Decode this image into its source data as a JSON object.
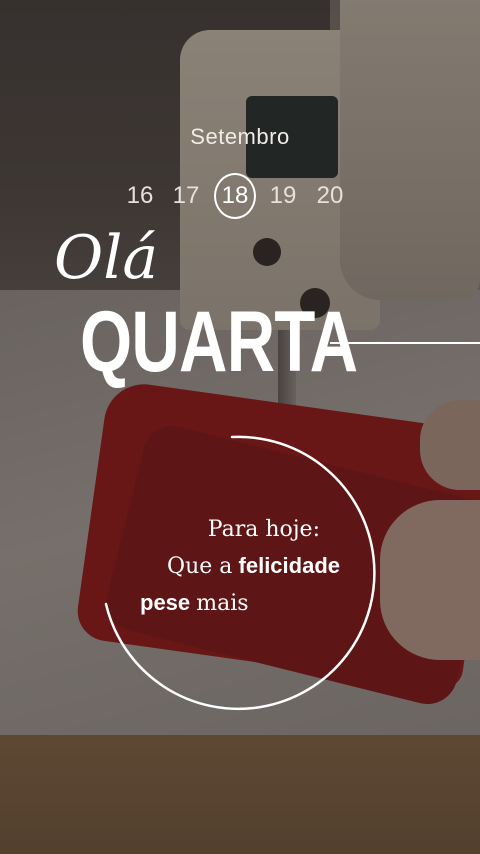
{
  "calendar": {
    "month": "Setembro",
    "days": [
      "16",
      "17",
      "18",
      "19",
      "20"
    ],
    "current_day": "18"
  },
  "greeting": {
    "hello": "Olá",
    "weekday": "QUARTA"
  },
  "message": {
    "line1": "Para hoje:",
    "line2_prefix": "Que a",
    "line2_emphasis": "felicidade",
    "line3_emphasis": "pese",
    "line3_suffix": "mais"
  },
  "colors": {
    "text": "#ffffff",
    "fabric": "#8b1212"
  }
}
